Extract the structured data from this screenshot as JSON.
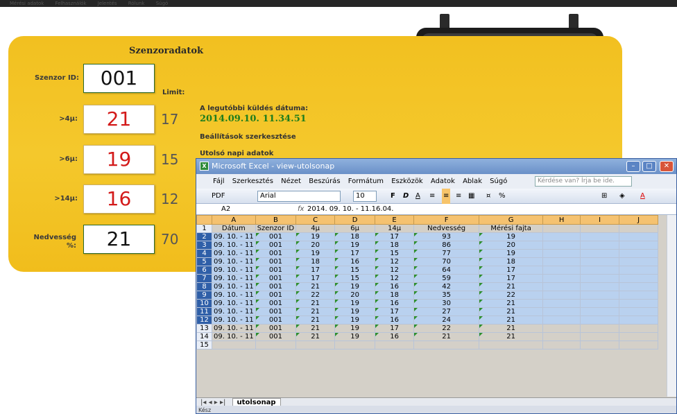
{
  "topbar": {
    "items": [
      "Mérési adatok",
      "Felhasználók",
      "Jelentés",
      "Rólunk",
      "Súgó"
    ]
  },
  "panel": {
    "title": "Szenzoradatok",
    "limit_label": "Limit:",
    "sensor_id_label": "Szenzor ID:",
    "sensor_id": "001",
    "rows": [
      {
        "label": ">4µ:",
        "value": "21",
        "limit": "17"
      },
      {
        "label": ">6µ:",
        "value": "19",
        "limit": "15"
      },
      {
        "label": ">14µ:",
        "value": "16",
        "limit": "12"
      },
      {
        "label": "Nedvesség %:",
        "value": "21",
        "limit": "70"
      }
    ],
    "last_send_label": "A legutóbbi küldés dátuma:",
    "last_send_date": "2014.09.10. 11.34.51",
    "settings_link": "Beállítások szerkesztése",
    "last_day_link": "Utolsó napi adatok"
  },
  "excel": {
    "title": "Microsoft Excel - view-utolsonap",
    "menu": [
      "Fájl",
      "Szerkesztés",
      "Nézet",
      "Beszúrás",
      "Formátum",
      "Eszközök",
      "Adatok",
      "Ablak",
      "Súgó"
    ],
    "question_placeholder": "Kérdése van? Írja be ide.",
    "pdf_label": "PDF",
    "font_name": "Arial",
    "font_size": "10",
    "cell_ref": "A2",
    "formula": "2014. 09. 10. - 11.16.04.",
    "col_letters": [
      "A",
      "B",
      "C",
      "D",
      "E",
      "F",
      "G",
      "H",
      "I",
      "J"
    ],
    "headers": [
      "Dátum",
      "Szenzor ID",
      "4µ",
      "6µ",
      "14µ",
      "Nedvesség",
      "Mérési fajta",
      "",
      "",
      ""
    ],
    "rows": [
      [
        "09. 10. - 11",
        "001",
        "19",
        "18",
        "17",
        "93",
        "19"
      ],
      [
        "09. 10. - 11",
        "001",
        "20",
        "19",
        "18",
        "86",
        "20"
      ],
      [
        "09. 10. - 11",
        "001",
        "19",
        "17",
        "15",
        "77",
        "19"
      ],
      [
        "09. 10. - 11",
        "001",
        "18",
        "16",
        "12",
        "70",
        "18"
      ],
      [
        "09. 10. - 11",
        "001",
        "17",
        "15",
        "12",
        "64",
        "17"
      ],
      [
        "09. 10. - 11",
        "001",
        "17",
        "15",
        "12",
        "59",
        "17"
      ],
      [
        "09. 10. - 11",
        "001",
        "21",
        "19",
        "16",
        "42",
        "21"
      ],
      [
        "09. 10. - 11",
        "001",
        "22",
        "20",
        "18",
        "35",
        "22"
      ],
      [
        "09. 10. - 11",
        "001",
        "21",
        "19",
        "16",
        "30",
        "21"
      ],
      [
        "09. 10. - 11",
        "001",
        "21",
        "19",
        "17",
        "27",
        "21"
      ],
      [
        "09. 10. - 11",
        "001",
        "21",
        "19",
        "16",
        "24",
        "21"
      ],
      [
        "09. 10. - 11",
        "001",
        "21",
        "19",
        "17",
        "22",
        "21"
      ],
      [
        "09. 10. - 11",
        "001",
        "21",
        "19",
        "16",
        "21",
        "21"
      ]
    ],
    "selected_rows": 11,
    "sheet_tab": "utolsonap",
    "status": "Kész"
  }
}
